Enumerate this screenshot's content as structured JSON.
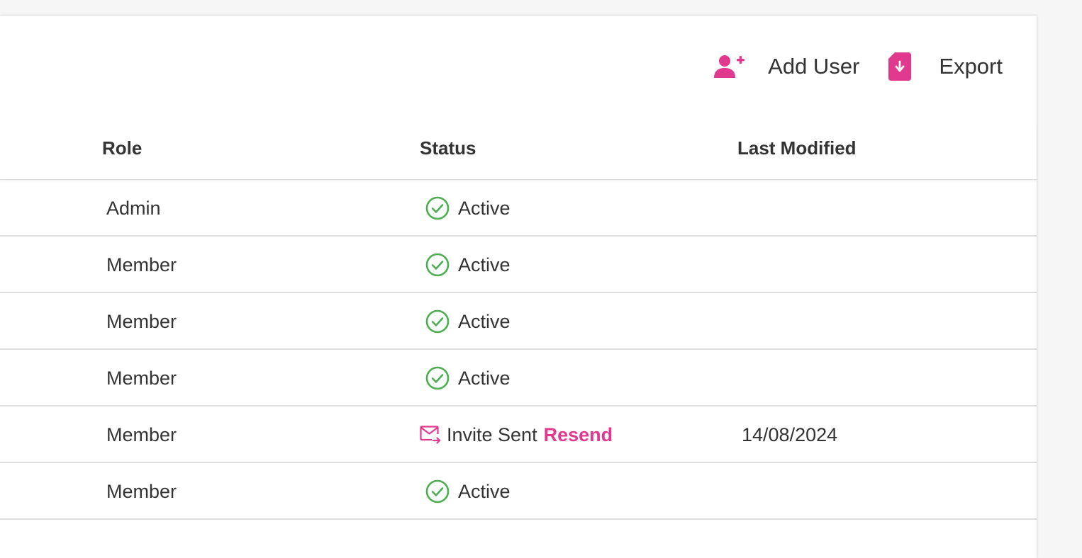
{
  "toolbar": {
    "add_user_label": "Add User",
    "export_label": "Export",
    "accent_color": "#e0398e"
  },
  "table": {
    "columns": {
      "role": "Role",
      "status": "Status",
      "last_modified": "Last Modified"
    },
    "status_active_color": "#4caf50",
    "rows": [
      {
        "role": "Admin",
        "status": "Active",
        "status_icon": "check-circle-icon",
        "last_modified": ""
      },
      {
        "role": "Member",
        "status": "Active",
        "status_icon": "check-circle-icon",
        "last_modified": ""
      },
      {
        "role": "Member",
        "status": "Active",
        "status_icon": "check-circle-icon",
        "last_modified": ""
      },
      {
        "role": "Member",
        "status": "Active",
        "status_icon": "check-circle-icon",
        "last_modified": ""
      },
      {
        "role": "Member",
        "status": "Invite Sent",
        "status_icon": "mail-sent-icon",
        "action": "Resend",
        "last_modified": "14/08/2024"
      },
      {
        "role": "Member",
        "status": "Active",
        "status_icon": "check-circle-icon",
        "last_modified": ""
      }
    ]
  }
}
